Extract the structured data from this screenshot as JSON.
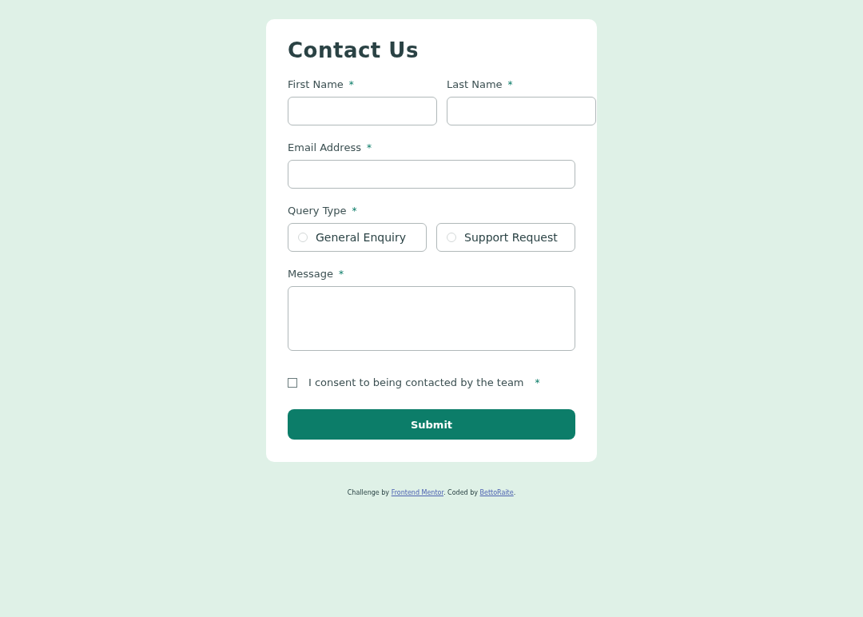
{
  "title": "Contact Us",
  "name_fields": [
    {
      "label": "First Name",
      "required_mark": "*"
    },
    {
      "label": "Last Name",
      "required_mark": "*"
    }
  ],
  "email": {
    "label": "Email Address",
    "required_mark": "*"
  },
  "query_type": {
    "label": "Query Type",
    "required_mark": "*",
    "options": [
      {
        "label": "General Enquiry",
        "selected": false
      },
      {
        "label": "Support Request",
        "selected": false
      }
    ]
  },
  "message": {
    "label": "Message",
    "required_mark": "*"
  },
  "consent": {
    "label": "I consent to being contacted by the team",
    "required_mark": "*",
    "checked": false
  },
  "submit": "Submit",
  "attribution": [
    {
      "kind": "text",
      "text": "Challenge by "
    },
    {
      "kind": "link",
      "text": "Frontend Mentor"
    },
    {
      "kind": "text",
      "text": ". Coded by "
    },
    {
      "kind": "link",
      "text": "BettoRaite"
    },
    {
      "kind": "text",
      "text": "."
    }
  ]
}
